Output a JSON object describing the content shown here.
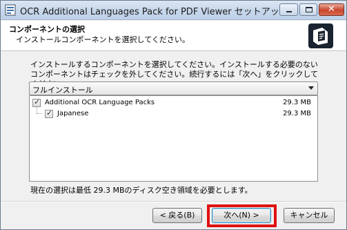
{
  "window": {
    "title": "OCR Additional Languages Pack for PDF Viewer セットアップ"
  },
  "header": {
    "title": "コンポーネントの選択",
    "subtitle": "インストールコンポーネントを選択してください。"
  },
  "description": "インストールするコンポーネントを選択してください。インストールする必要のないコンポーネントはチェックを外してください。続行するには「次へ」をクリックしてください。",
  "install_type": {
    "selected": "フルインストール"
  },
  "components": [
    {
      "label": "Additional OCR Language Packs",
      "size": "29.3 MB",
      "checked": true
    },
    {
      "label": "Japanese",
      "size": "29.3 MB",
      "checked": true
    }
  ],
  "space_note": "現在の選択は最低 29.3 MBのディスク空き領域を必要とします。",
  "buttons": {
    "back": "< 戻る(B)",
    "next": "次へ(N) >",
    "cancel": "キャンセル"
  },
  "colors": {
    "highlight": "#e01010",
    "titlebar": "#c8d8ec"
  }
}
